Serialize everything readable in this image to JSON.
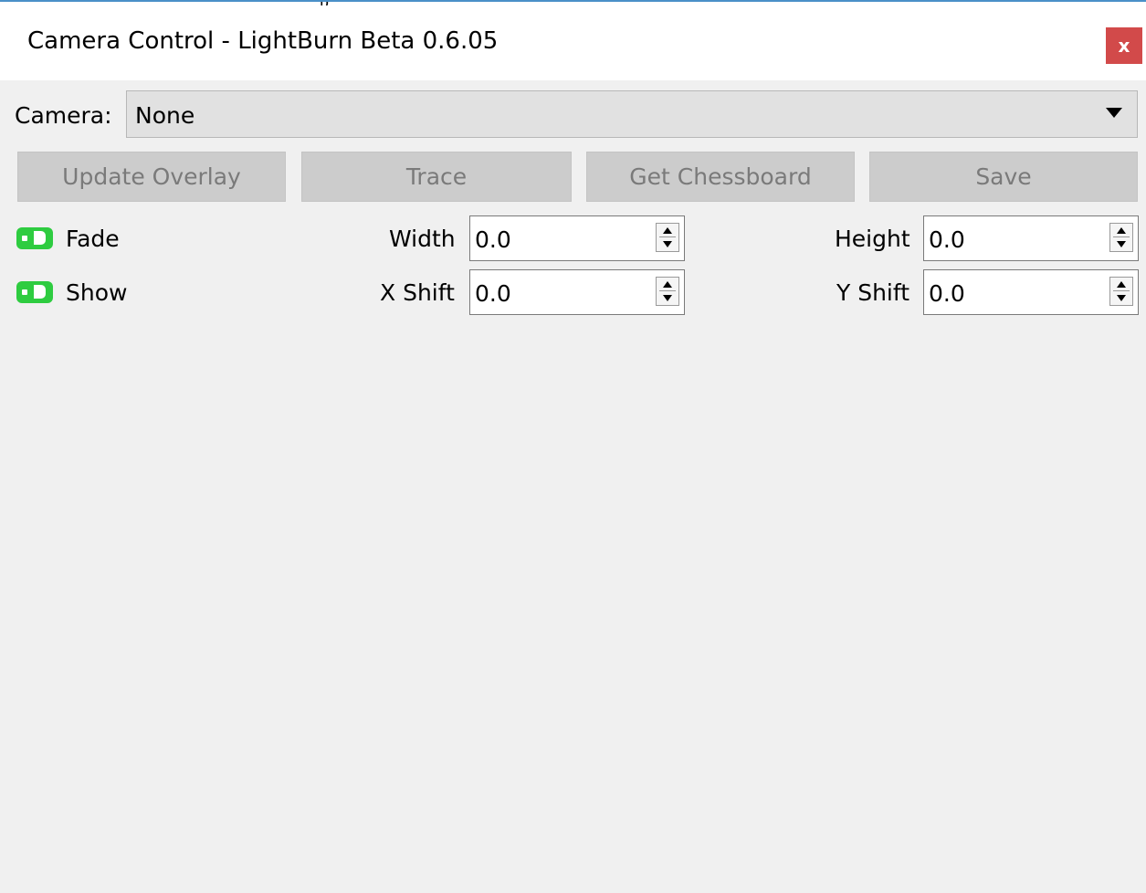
{
  "window": {
    "top_fragment": "p",
    "title": "Camera Control - LightBurn Beta 0.6.05",
    "close_label": "x"
  },
  "camera": {
    "label": "Camera:",
    "selected": "None"
  },
  "buttons": {
    "update_overlay": "Update Overlay",
    "trace": "Trace",
    "get_chessboard": "Get Chessboard",
    "save": "Save"
  },
  "toggles": {
    "fade": {
      "label": "Fade",
      "on": true
    },
    "show": {
      "label": "Show",
      "on": true
    }
  },
  "fields": {
    "width": {
      "label": "Width",
      "value": "0.0"
    },
    "height": {
      "label": "Height",
      "value": "0.0"
    },
    "x_shift": {
      "label": "X Shift",
      "value": "0.0"
    },
    "y_shift": {
      "label": "Y Shift",
      "value": "0.0"
    }
  },
  "colors": {
    "toggle_on": "#2ecc40",
    "close_button": "#d24a4a",
    "disabled_button": "#cccccc",
    "disabled_text": "#7a7a7a",
    "dialog_background": "#f0f0f0"
  }
}
